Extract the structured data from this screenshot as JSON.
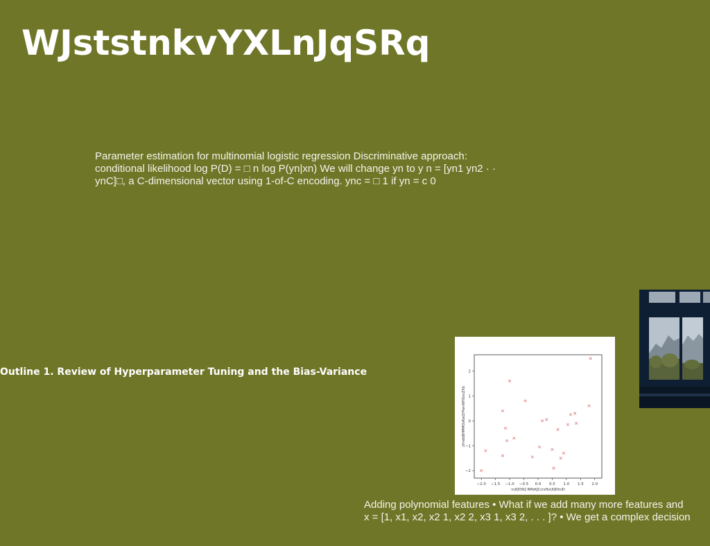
{
  "slide": {
    "title": "WJststnkvYXLnJqSRq",
    "paragraph": "Parameter estimation for multinomial logistic regression Discriminative approach: conditional likelihood log P(D) = □ n log P(yn|xn) We will change yn to y n = [yn1 yn2 · · ynC]□, a C-dimensional vector using 1-of-C encoding. ync = □ 1 if yn = c 0",
    "outline": "Outline 1. Review of Hyperparameter Tuning and the Bias-Variance",
    "caption_line1": "Adding polynomial features • What if we add many more features and",
    "caption_line2": "x = [1, x1, x2, x2 1, x2 2, x3 1, x3 2, . . . ]? • We get a complex decision"
  },
  "colors": {
    "background": "#6f7628",
    "marker": "#e07a7a"
  },
  "photo": {
    "icon": "window-view-photo"
  },
  "chart_data": {
    "type": "scatter",
    "xlabel": "nrJQOSQ RMzKJCcrsHxUQDtciD",
    "ylabel": "zlmdsBHMMOzKwZrPwvWHUsvZXb",
    "xlim": [
      -2.25,
      2.25
    ],
    "ylim": [
      -2.3,
      2.65
    ],
    "xticks": [
      "−2.0",
      "−1.5",
      "−1.0",
      "−0.5",
      "0.0",
      "0.5",
      "1.0",
      "1.5",
      "2.0"
    ],
    "yticks": [
      "−2",
      "−1",
      "0",
      "1",
      "2"
    ],
    "marker": "x",
    "points": [
      {
        "x": -2.0,
        "y": -2.0
      },
      {
        "x": -1.85,
        "y": -1.2
      },
      {
        "x": -1.25,
        "y": 0.4
      },
      {
        "x": -1.25,
        "y": -1.4
      },
      {
        "x": -1.15,
        "y": -0.3
      },
      {
        "x": -1.1,
        "y": -0.8
      },
      {
        "x": -1.0,
        "y": 1.6
      },
      {
        "x": -0.85,
        "y": -0.7
      },
      {
        "x": -0.45,
        "y": 0.8
      },
      {
        "x": -0.2,
        "y": -1.45
      },
      {
        "x": 0.05,
        "y": -1.05
      },
      {
        "x": 0.15,
        "y": 0.0
      },
      {
        "x": 0.3,
        "y": 0.05
      },
      {
        "x": 0.5,
        "y": -1.15
      },
      {
        "x": 0.55,
        "y": -1.9
      },
      {
        "x": 0.7,
        "y": -0.35
      },
      {
        "x": 0.8,
        "y": -1.5
      },
      {
        "x": 0.9,
        "y": -1.3
      },
      {
        "x": 1.05,
        "y": -0.15
      },
      {
        "x": 1.15,
        "y": 0.25
      },
      {
        "x": 1.3,
        "y": 0.3
      },
      {
        "x": 1.35,
        "y": -0.1
      },
      {
        "x": 1.8,
        "y": 0.6
      },
      {
        "x": 1.85,
        "y": 2.5
      }
    ]
  }
}
